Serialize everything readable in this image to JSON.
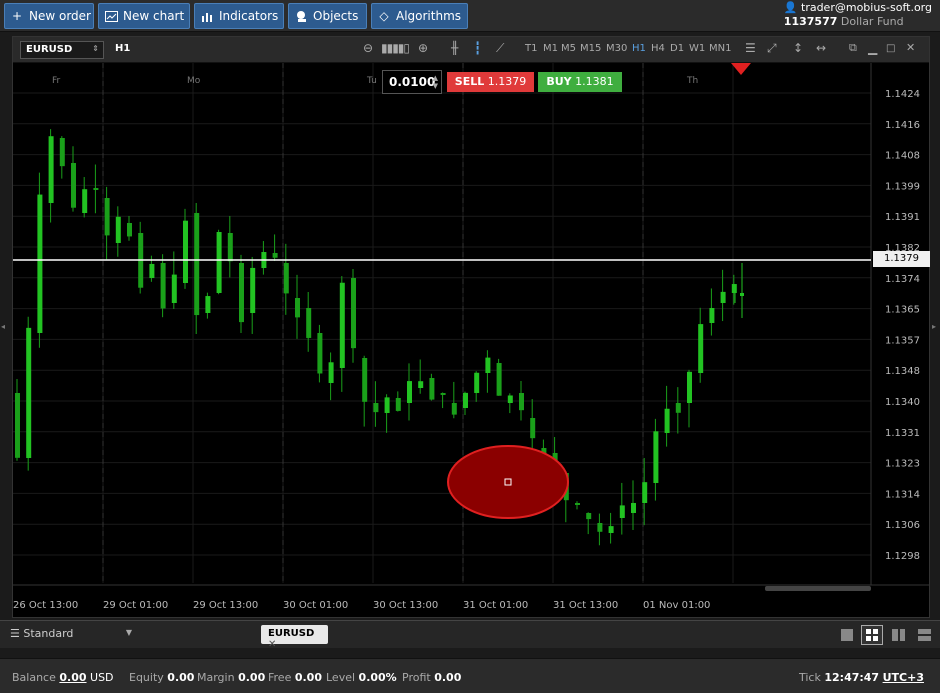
{
  "toolbar": {
    "new_order": "New order",
    "new_chart": "New chart",
    "indicators": "Indicators",
    "objects": "Objects",
    "algorithms": "Algorithms"
  },
  "user": {
    "email": "trader@mobius-soft.org",
    "account": "1137577",
    "fund": "Dollar Fund"
  },
  "chart": {
    "symbol": "EURUSD",
    "timeframe": "H1",
    "timeframes": [
      "T1",
      "M1",
      "M5",
      "M15",
      "M30",
      "H1",
      "H4",
      "D1",
      "W1",
      "MN1"
    ],
    "active_timeframe": "H1",
    "lot": "0.0100",
    "sell_label": "SELL",
    "sell_price": "1.1379",
    "buy_label": "BUY",
    "buy_price": "1.1381",
    "current_price": "1.1379",
    "y_ticks": [
      "1.1424",
      "1.1416",
      "1.1408",
      "1.1399",
      "1.1391",
      "1.1382",
      "1.1374",
      "1.1365",
      "1.1357",
      "1.1348",
      "1.1340",
      "1.1331",
      "1.1323",
      "1.1314",
      "1.1306",
      "1.1298"
    ],
    "day_labels": [
      "Fr",
      "Mo",
      "Tu",
      "Th"
    ],
    "x_ticks": [
      "26 Oct 13:00",
      "29 Oct 01:00",
      "29 Oct 13:00",
      "30 Oct 01:00",
      "30 Oct 13:00",
      "31 Oct 01:00",
      "31 Oct 13:00",
      "01 Nov 01:00"
    ],
    "colors": {
      "bull": "#22c322",
      "bear": "#1aa01a",
      "sell": "#e03a3a",
      "buy": "#3fae3f",
      "marker": "#8b0000"
    }
  },
  "tabs": {
    "layout": "Standard",
    "active_tab": "EURUSD"
  },
  "status": {
    "balance_label": "Balance",
    "balance": "0.00",
    "currency": "USD",
    "equity_label": "Equity",
    "equity": "0.00",
    "margin_label": "Margin",
    "margin": "0.00",
    "free_label": "Free",
    "free": "0.00",
    "level_label": "Level",
    "level": "0.00%",
    "profit_label": "Profit",
    "profit": "0.00",
    "tick_label": "Tick",
    "time": "12:47:47",
    "tz": "UTC+3"
  }
}
